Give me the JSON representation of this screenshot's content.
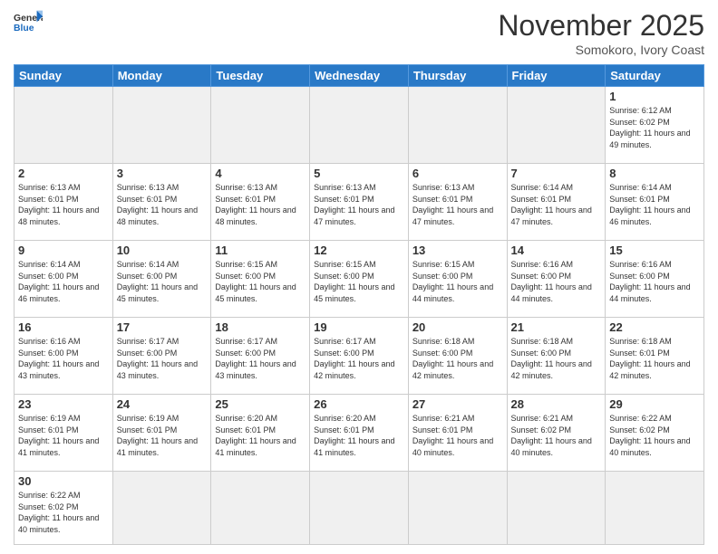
{
  "header": {
    "logo_general": "General",
    "logo_blue": "Blue",
    "month_title": "November 2025",
    "location": "Somokoro, Ivory Coast"
  },
  "weekdays": [
    "Sunday",
    "Monday",
    "Tuesday",
    "Wednesday",
    "Thursday",
    "Friday",
    "Saturday"
  ],
  "weeks": [
    [
      {
        "day": "",
        "empty": true
      },
      {
        "day": "",
        "empty": true
      },
      {
        "day": "",
        "empty": true
      },
      {
        "day": "",
        "empty": true
      },
      {
        "day": "",
        "empty": true
      },
      {
        "day": "",
        "empty": true
      },
      {
        "day": "1",
        "sunrise": "6:12 AM",
        "sunset": "6:02 PM",
        "daylight": "11 hours and 49 minutes."
      }
    ],
    [
      {
        "day": "2",
        "sunrise": "6:13 AM",
        "sunset": "6:01 PM",
        "daylight": "11 hours and 48 minutes."
      },
      {
        "day": "3",
        "sunrise": "6:13 AM",
        "sunset": "6:01 PM",
        "daylight": "11 hours and 48 minutes."
      },
      {
        "day": "4",
        "sunrise": "6:13 AM",
        "sunset": "6:01 PM",
        "daylight": "11 hours and 48 minutes."
      },
      {
        "day": "5",
        "sunrise": "6:13 AM",
        "sunset": "6:01 PM",
        "daylight": "11 hours and 47 minutes."
      },
      {
        "day": "6",
        "sunrise": "6:13 AM",
        "sunset": "6:01 PM",
        "daylight": "11 hours and 47 minutes."
      },
      {
        "day": "7",
        "sunrise": "6:14 AM",
        "sunset": "6:01 PM",
        "daylight": "11 hours and 47 minutes."
      },
      {
        "day": "8",
        "sunrise": "6:14 AM",
        "sunset": "6:01 PM",
        "daylight": "11 hours and 46 minutes."
      }
    ],
    [
      {
        "day": "9",
        "sunrise": "6:14 AM",
        "sunset": "6:00 PM",
        "daylight": "11 hours and 46 minutes."
      },
      {
        "day": "10",
        "sunrise": "6:14 AM",
        "sunset": "6:00 PM",
        "daylight": "11 hours and 45 minutes."
      },
      {
        "day": "11",
        "sunrise": "6:15 AM",
        "sunset": "6:00 PM",
        "daylight": "11 hours and 45 minutes."
      },
      {
        "day": "12",
        "sunrise": "6:15 AM",
        "sunset": "6:00 PM",
        "daylight": "11 hours and 45 minutes."
      },
      {
        "day": "13",
        "sunrise": "6:15 AM",
        "sunset": "6:00 PM",
        "daylight": "11 hours and 44 minutes."
      },
      {
        "day": "14",
        "sunrise": "6:16 AM",
        "sunset": "6:00 PM",
        "daylight": "11 hours and 44 minutes."
      },
      {
        "day": "15",
        "sunrise": "6:16 AM",
        "sunset": "6:00 PM",
        "daylight": "11 hours and 44 minutes."
      }
    ],
    [
      {
        "day": "16",
        "sunrise": "6:16 AM",
        "sunset": "6:00 PM",
        "daylight": "11 hours and 43 minutes."
      },
      {
        "day": "17",
        "sunrise": "6:17 AM",
        "sunset": "6:00 PM",
        "daylight": "11 hours and 43 minutes."
      },
      {
        "day": "18",
        "sunrise": "6:17 AM",
        "sunset": "6:00 PM",
        "daylight": "11 hours and 43 minutes."
      },
      {
        "day": "19",
        "sunrise": "6:17 AM",
        "sunset": "6:00 PM",
        "daylight": "11 hours and 42 minutes."
      },
      {
        "day": "20",
        "sunrise": "6:18 AM",
        "sunset": "6:00 PM",
        "daylight": "11 hours and 42 minutes."
      },
      {
        "day": "21",
        "sunrise": "6:18 AM",
        "sunset": "6:00 PM",
        "daylight": "11 hours and 42 minutes."
      },
      {
        "day": "22",
        "sunrise": "6:18 AM",
        "sunset": "6:01 PM",
        "daylight": "11 hours and 42 minutes."
      }
    ],
    [
      {
        "day": "23",
        "sunrise": "6:19 AM",
        "sunset": "6:01 PM",
        "daylight": "11 hours and 41 minutes."
      },
      {
        "day": "24",
        "sunrise": "6:19 AM",
        "sunset": "6:01 PM",
        "daylight": "11 hours and 41 minutes."
      },
      {
        "day": "25",
        "sunrise": "6:20 AM",
        "sunset": "6:01 PM",
        "daylight": "11 hours and 41 minutes."
      },
      {
        "day": "26",
        "sunrise": "6:20 AM",
        "sunset": "6:01 PM",
        "daylight": "11 hours and 41 minutes."
      },
      {
        "day": "27",
        "sunrise": "6:21 AM",
        "sunset": "6:01 PM",
        "daylight": "11 hours and 40 minutes."
      },
      {
        "day": "28",
        "sunrise": "6:21 AM",
        "sunset": "6:02 PM",
        "daylight": "11 hours and 40 minutes."
      },
      {
        "day": "29",
        "sunrise": "6:22 AM",
        "sunset": "6:02 PM",
        "daylight": "11 hours and 40 minutes."
      }
    ],
    [
      {
        "day": "30",
        "sunrise": "6:22 AM",
        "sunset": "6:02 PM",
        "daylight": "11 hours and 40 minutes."
      },
      {
        "day": "",
        "empty": true
      },
      {
        "day": "",
        "empty": true
      },
      {
        "day": "",
        "empty": true
      },
      {
        "day": "",
        "empty": true
      },
      {
        "day": "",
        "empty": true
      },
      {
        "day": "",
        "empty": true
      }
    ]
  ]
}
